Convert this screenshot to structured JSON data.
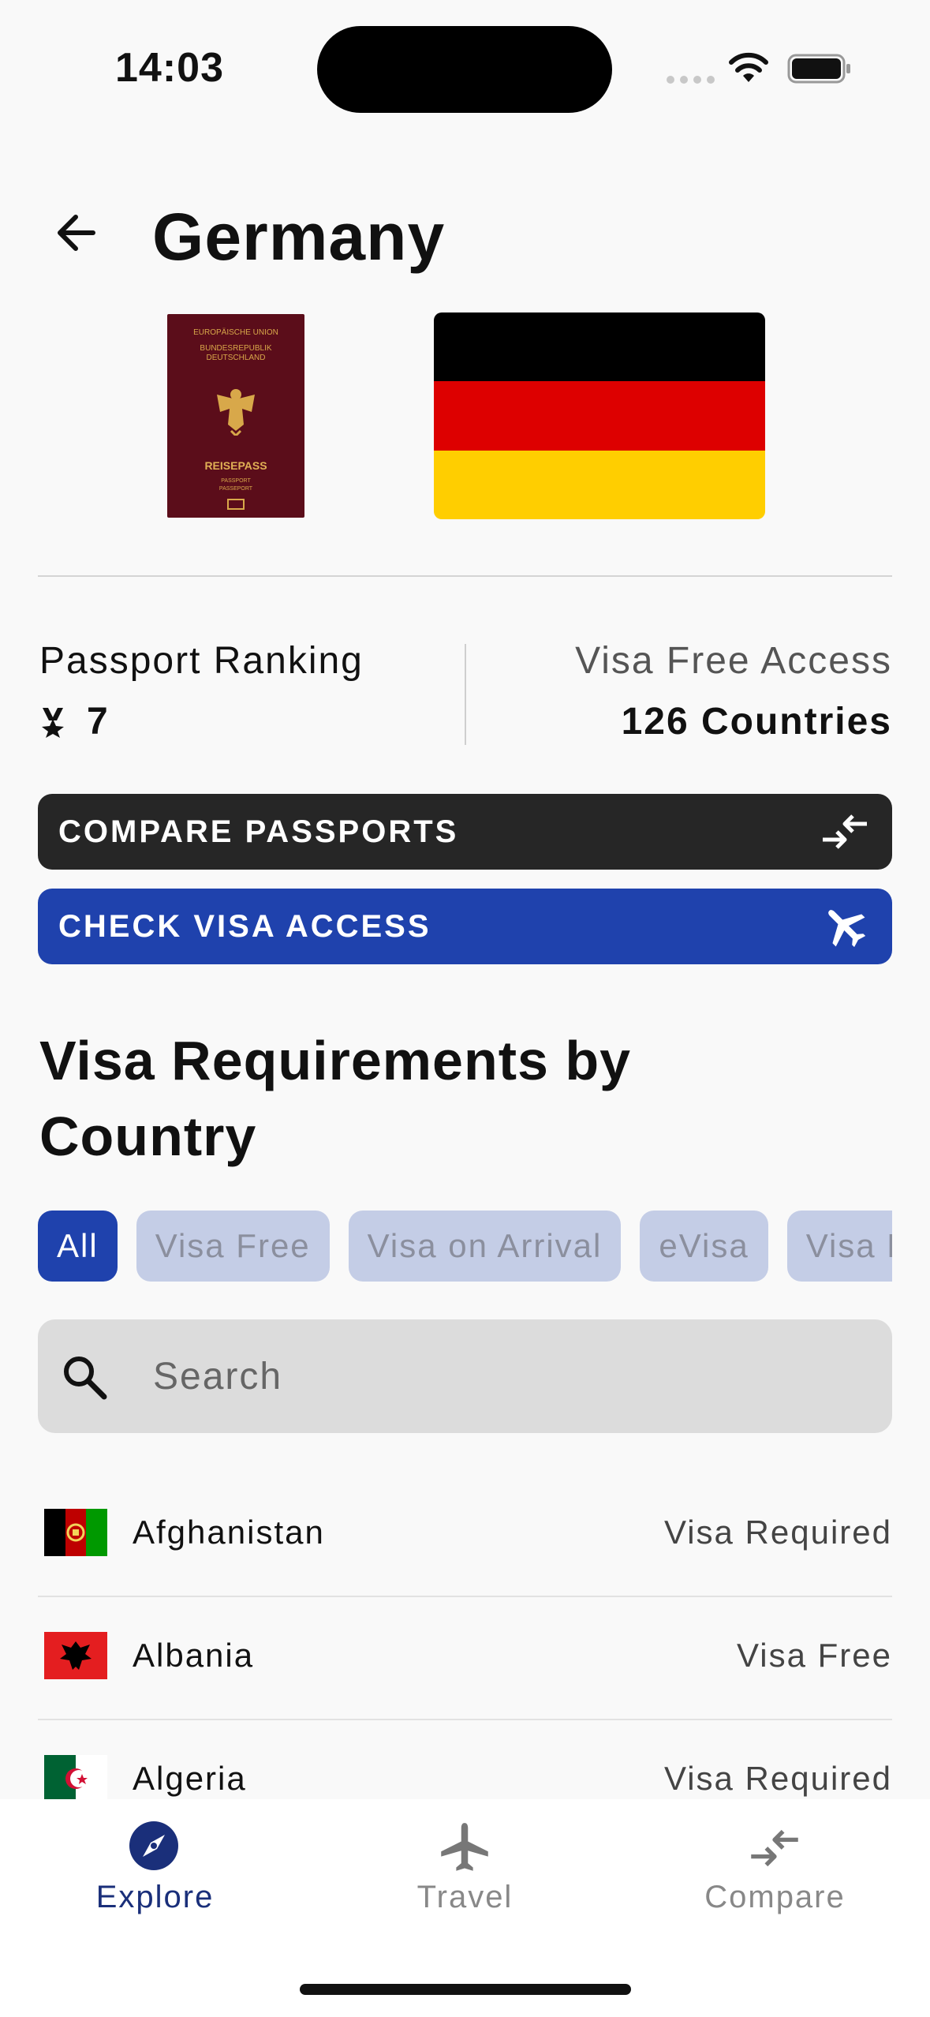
{
  "status_bar": {
    "time": "14:03"
  },
  "header": {
    "title": "Germany",
    "back_icon": "arrow-left-icon"
  },
  "passport": {
    "top_line1": "EUROPÄISCHE UNION",
    "top_line2": "BUNDESREPUBLIK",
    "top_line3": "DEUTSCHLAND",
    "name": "REISEPASS",
    "sub1": "PASSPORT",
    "sub2": "PASSEPORT"
  },
  "flag_colors": [
    "#000000",
    "#DD0000",
    "#FFCE00"
  ],
  "stats": {
    "ranking_label": "Passport Ranking",
    "ranking_value": "7",
    "access_label": "Visa Free Access",
    "access_value": "126 Countries"
  },
  "buttons": {
    "compare_label": "COMPARE PASSPORTS",
    "compare_icon": "compare-arrows-icon",
    "visa_label": "CHECK VISA ACCESS",
    "visa_icon": "airplane-icon"
  },
  "section": {
    "title": "Visa Requirements by Country"
  },
  "filters": [
    "All",
    "Visa Free",
    "Visa on Arrival",
    "eVisa",
    "Visa Required"
  ],
  "active_filter": "All",
  "search": {
    "placeholder": "Search",
    "value": ""
  },
  "countries": [
    {
      "name": "Afghanistan",
      "status": "Visa Required"
    },
    {
      "name": "Albania",
      "status": "Visa Free"
    },
    {
      "name": "Algeria",
      "status": "Visa Required"
    }
  ],
  "nav": {
    "explore": "Explore",
    "travel": "Travel",
    "compare": "Compare"
  },
  "colors": {
    "accent": "#1F42AD",
    "dark_button": "#262626",
    "chip_inactive": "#C4CDE6"
  }
}
